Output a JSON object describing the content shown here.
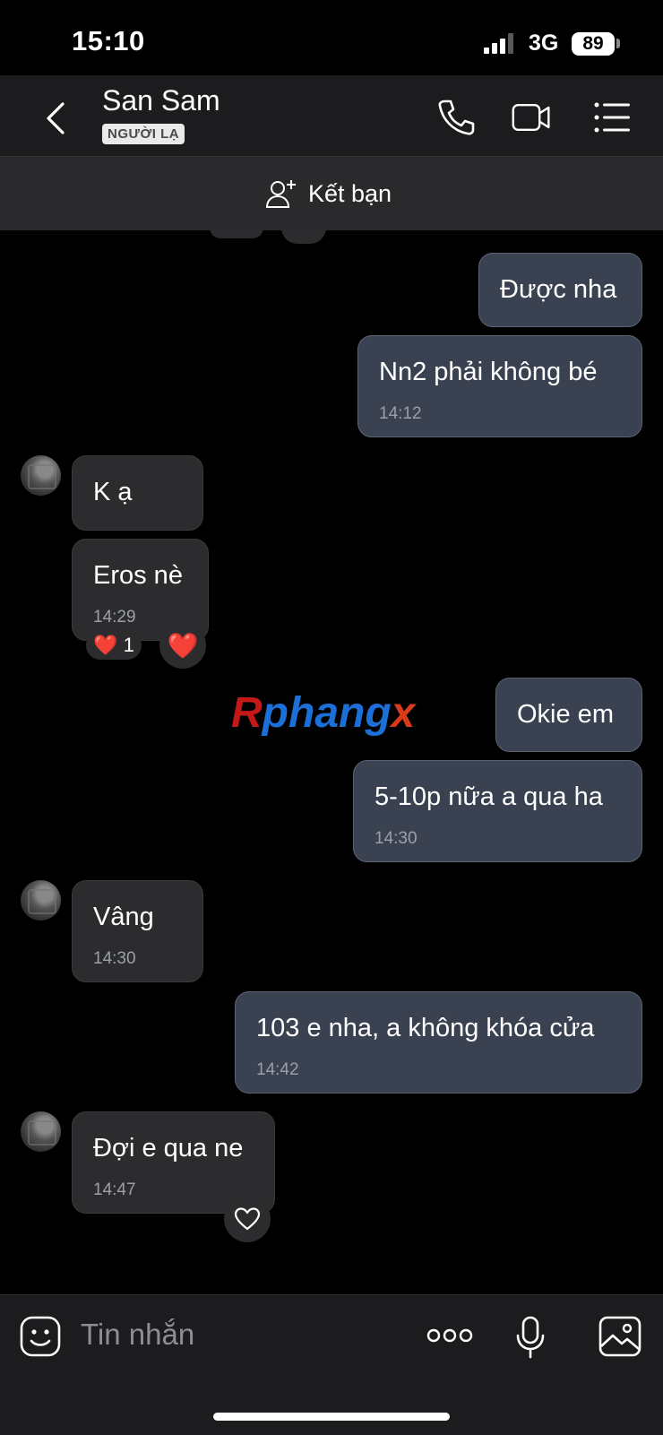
{
  "status": {
    "time": "15:10",
    "network": "3G",
    "battery": "89"
  },
  "header": {
    "title": "San Sam",
    "badge": "NGƯỜI LẠ",
    "icons": [
      "back-icon",
      "phone-icon",
      "video-icon",
      "menu-icon"
    ]
  },
  "add_friend": {
    "label": "Kết bạn"
  },
  "messages": [
    {
      "from": "me",
      "text": "Được nha"
    },
    {
      "from": "me",
      "text": "Nn2 phải không bé",
      "time": "14:12"
    },
    {
      "from": "them",
      "text": "K ạ"
    },
    {
      "from": "them",
      "text": "Eros nè",
      "time": "14:29",
      "reaction": "❤️",
      "reaction_count": "1"
    },
    {
      "from": "me",
      "text": "Okie em"
    },
    {
      "from": "me",
      "text": "5-10p nữa a qua ha",
      "time": "14:30"
    },
    {
      "from": "them",
      "text": "Vâng",
      "time": "14:30"
    },
    {
      "from": "me",
      "text": "103 e nha, a không khóa cửa",
      "time": "14:42"
    },
    {
      "from": "them",
      "text": "Đợi e qua ne",
      "time": "14:47"
    }
  ],
  "watermark": {
    "r": "R",
    "mid": "phang",
    "x": "x"
  },
  "composer": {
    "placeholder": "Tin nhắn",
    "icons": [
      "sticker-icon",
      "more-icon",
      "mic-icon",
      "image-icon"
    ]
  },
  "colors": {
    "my_bubble": "#3a4150",
    "their_bubble": "#2c2c2e",
    "background": "#000000"
  }
}
